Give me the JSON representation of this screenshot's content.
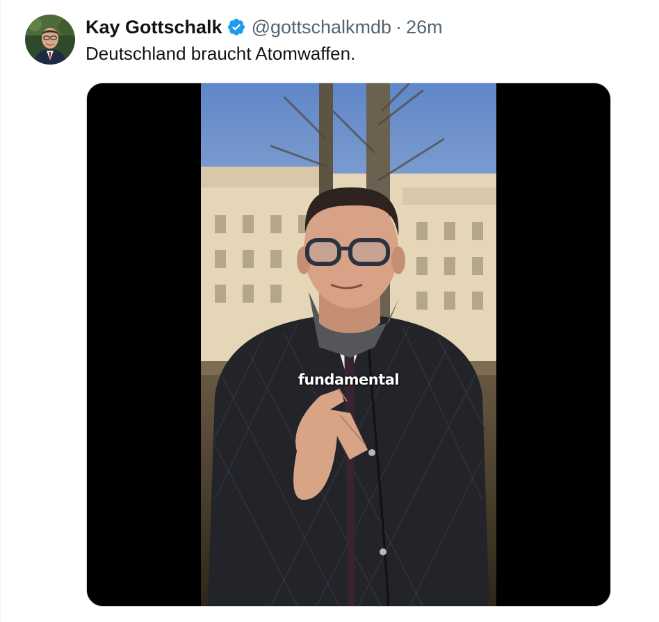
{
  "tweet": {
    "author_name": "Kay Gottschalk",
    "verified": true,
    "handle": "@gottschalkmdb",
    "separator": "·",
    "time": "26m",
    "text": "Deutschland braucht Atomwaffen."
  },
  "media": {
    "type": "video",
    "caption": "fundamental"
  },
  "colors": {
    "text_primary": "#0f1419",
    "text_secondary": "#536471",
    "verified_blue": "#1d9bf0",
    "media_background": "#000000"
  },
  "icons": {
    "verified": "verified-badge-icon"
  }
}
